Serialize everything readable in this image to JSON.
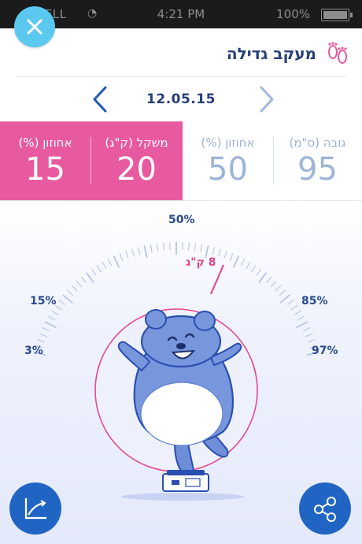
{
  "status_bar": {
    "carrier": "BELL",
    "time": "4:21 PM",
    "battery": "100%"
  },
  "header": {
    "title": "מעקב גדילה"
  },
  "date_nav": {
    "date": "12.05.15"
  },
  "stats": [
    {
      "label": "אחוזון (%)",
      "value": "15",
      "highlight": true
    },
    {
      "label": "משקל (ק\"ג)",
      "value": "20",
      "highlight": true
    },
    {
      "label": "אחוזון (%)",
      "value": "50",
      "highlight": false
    },
    {
      "label": "גובה (ס\"מ)",
      "value": "95",
      "highlight": false
    }
  ],
  "gauge": {
    "percentile_labels": {
      "p3": "3%",
      "p15": "15%",
      "p50": "50%",
      "p85": "85%",
      "p97": "97%"
    },
    "marker_label": "8 ק\"ג"
  },
  "colors": {
    "pink": "#e85a9f",
    "navy": "#283f78",
    "blue": "#2165c4",
    "light_blue": "#5bc8f0"
  },
  "icons": {
    "close": "close-icon",
    "feet": "baby-feet-icon",
    "chart": "growth-chart-icon",
    "share": "share-icon"
  }
}
